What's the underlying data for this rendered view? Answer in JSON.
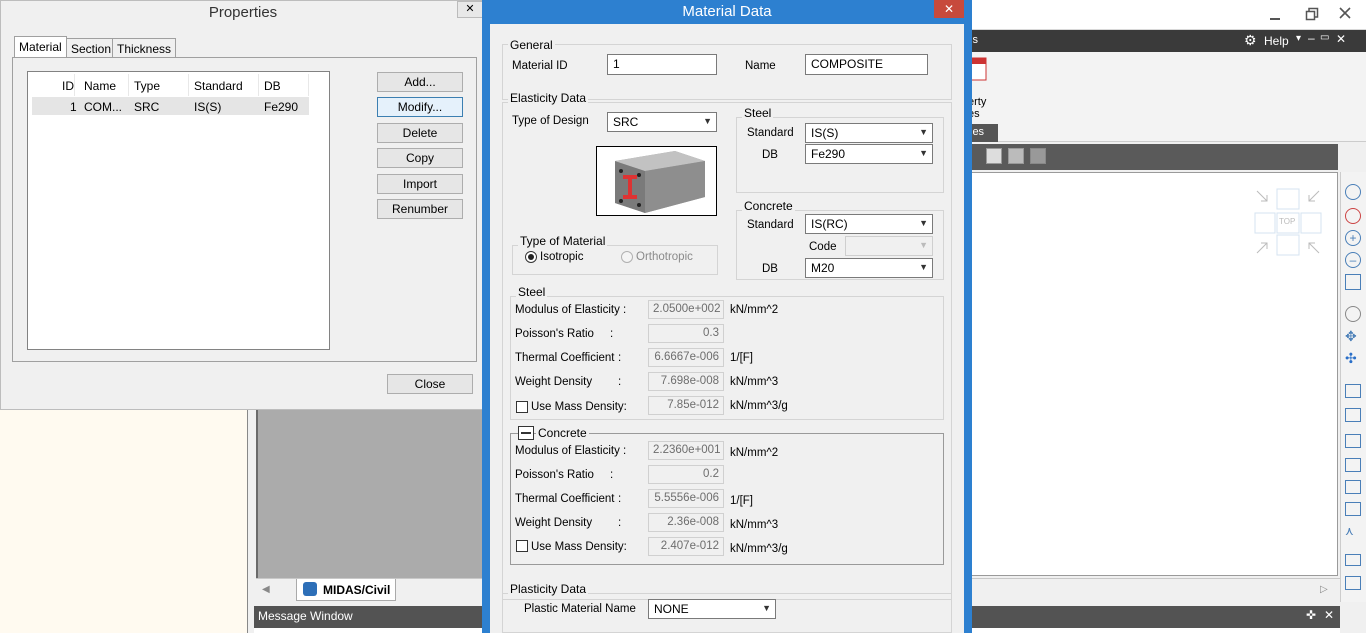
{
  "properties": {
    "title": "Properties",
    "tabs": [
      "Material",
      "Section",
      "Thickness"
    ],
    "table": {
      "headers": [
        "ID",
        "Name",
        "Type",
        "Standard",
        "DB"
      ],
      "rows": [
        {
          "id": "1",
          "name": "COM...",
          "type": "SRC",
          "standard": "IS(S)",
          "db": "Fe290"
        }
      ]
    },
    "buttons": {
      "add": "Add...",
      "modify": "Modify...",
      "delete": "Delete",
      "copy": "Copy",
      "import": "Import",
      "renumber": "Renumber",
      "close": "Close"
    }
  },
  "material": {
    "title": "Material Data",
    "general": {
      "title": "General",
      "id_label": "Material ID",
      "id_value": "1",
      "name_label": "Name",
      "name_value": "COMPOSITE"
    },
    "elasticity": {
      "title": "Elasticity Data",
      "design_label": "Type of Design",
      "design_value": "SRC",
      "steel_group": {
        "title": "Steel",
        "standard_label": "Standard",
        "standard_value": "IS(S)",
        "db_label": "DB",
        "db_value": "Fe290"
      },
      "concrete_group": {
        "title": "Concrete",
        "standard_label": "Standard",
        "standard_value": "IS(RC)",
        "code_label": "Code",
        "code_value": "",
        "db_label": "DB",
        "db_value": "M20"
      },
      "type_of_material": {
        "title": "Type of Material",
        "isotropic": "Isotropic",
        "orthotropic": "Orthotropic"
      }
    },
    "steel": {
      "title": "Steel",
      "modulus_label": "Modulus of Elasticity :",
      "modulus_value": "2.0500e+002",
      "modulus_unit": "kN/mm^2",
      "poisson_label": "Poisson's Ratio",
      "poisson_value": "0.3",
      "thermal_label": "Thermal Coefficient",
      "thermal_value": "6.6667e-006",
      "thermal_unit": "1/[F]",
      "weight_label": "Weight Density",
      "weight_value": "7.698e-008",
      "weight_unit": "kN/mm^3",
      "mass_label": "Use Mass Density:",
      "mass_value": "7.85e-012",
      "mass_unit": "kN/mm^3/g"
    },
    "concrete": {
      "title": "Concrete",
      "modulus_label": "Modulus of Elasticity :",
      "modulus_value": "2.2360e+001",
      "modulus_unit": "kN/mm^2",
      "poisson_label": "Poisson's Ratio",
      "poisson_value": "0.2",
      "thermal_label": "Thermal Coefficient",
      "thermal_value": "5.5556e-006",
      "thermal_unit": "1/[F]",
      "weight_label": "Weight Density",
      "weight_value": "2.36e-008",
      "weight_unit": "kN/mm^3",
      "mass_label": "Use Mass Density:",
      "mass_value": "2.407e-012",
      "mass_unit": "kN/mm^3/g"
    },
    "plasticity": {
      "title": "Plasticity Data",
      "name_label": "Plastic Material Name",
      "name_value": "NONE"
    },
    "colon": ":"
  },
  "app": {
    "help_label": "Help",
    "ribbon_fragment_1": "ls",
    "ribbon_fragment_2": "erty",
    "ribbon_fragment_3": "es",
    "ribbon_fragment_4": "les",
    "view_cube_label": "TOP",
    "tab_label": "MIDAS/Civil",
    "message_window": "Message Window"
  },
  "colors": {
    "accent": "#2d80d0",
    "message_bar": "#535353",
    "ribbon_bar": "#3a3a3a"
  }
}
